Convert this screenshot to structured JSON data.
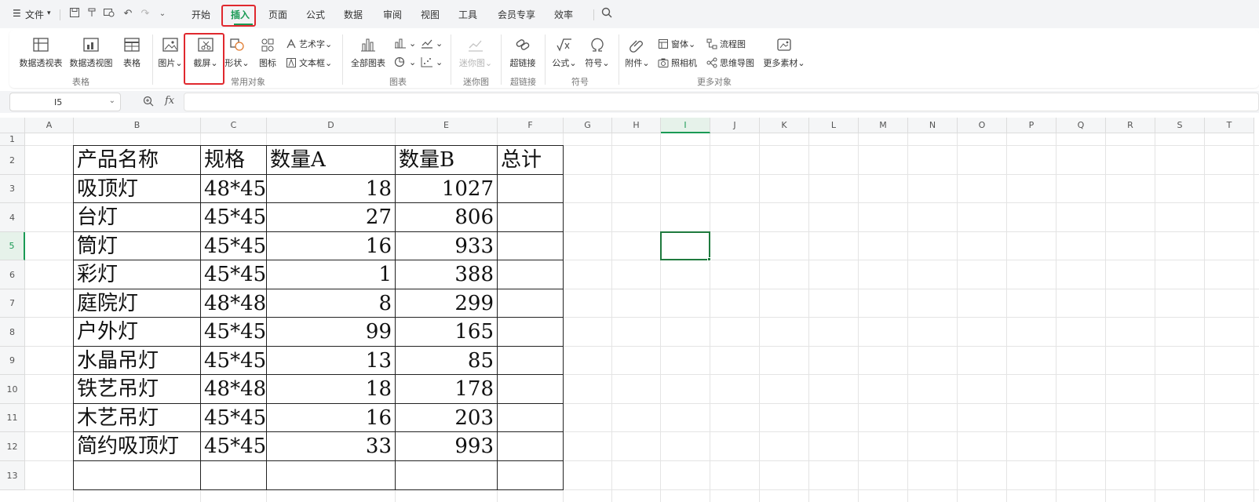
{
  "menu": {
    "file_label": "文件",
    "tabs": [
      {
        "label": "开始",
        "active": false
      },
      {
        "label": "插入",
        "active": true
      },
      {
        "label": "页面",
        "active": false
      },
      {
        "label": "公式",
        "active": false
      },
      {
        "label": "数据",
        "active": false
      },
      {
        "label": "审阅",
        "active": false
      },
      {
        "label": "视图",
        "active": false
      },
      {
        "label": "工具",
        "active": false
      },
      {
        "label": "会员专享",
        "active": false
      },
      {
        "label": "效率",
        "active": false
      }
    ]
  },
  "ribbon": {
    "table_group": {
      "name": "表格",
      "pivot_table": "数据透视表",
      "pivot_chart": "数据透视图",
      "table": "表格"
    },
    "common_group": {
      "name": "常用对象",
      "picture": "图片",
      "screenshot": "截屏",
      "shape": "形状",
      "icon": "图标",
      "wordart": "艺术字",
      "textbox": "文本框"
    },
    "chart_group": {
      "name": "图表",
      "all_charts": "全部图表"
    },
    "sparkline_group": {
      "name": "迷你图",
      "sparkline": "迷你图"
    },
    "hyperlink_group": {
      "name": "超链接",
      "hyperlink": "超链接"
    },
    "symbol_group": {
      "name": "符号",
      "formula": "公式",
      "symbol": "符号"
    },
    "more_group": {
      "name": "更多对象",
      "attachment": "附件",
      "window": "窗体",
      "camera": "照相机",
      "flowchart": "流程图",
      "mindmap": "思维导图",
      "more_material": "更多素材"
    }
  },
  "formula_bar": {
    "cell_ref": "I5",
    "fx": "fx",
    "value": ""
  },
  "accent_color": "#1a9a55",
  "highlight_color": "#e0282e",
  "sheet": {
    "columns": [
      "A",
      "B",
      "C",
      "D",
      "E",
      "F",
      "G",
      "H",
      "I",
      "J",
      "K",
      "L",
      "M",
      "N",
      "O",
      "P",
      "Q",
      "R",
      "S",
      "T"
    ],
    "rows": [
      "1",
      "2",
      "3",
      "4",
      "5",
      "6",
      "7",
      "8",
      "9",
      "10",
      "11",
      "12",
      "13"
    ],
    "selected_column": "I",
    "selected_row": "5",
    "header": [
      "产品名称",
      "规格",
      "数量A",
      "数量B",
      "总计"
    ],
    "data": [
      [
        "吸顶灯",
        "48*45",
        "18",
        "1027",
        ""
      ],
      [
        "台灯",
        "45*45",
        "27",
        "806",
        ""
      ],
      [
        "筒灯",
        "45*45",
        "16",
        "933",
        ""
      ],
      [
        "彩灯",
        "45*45",
        "1",
        "388",
        ""
      ],
      [
        "庭院灯",
        "48*48",
        "8",
        "299",
        ""
      ],
      [
        "户外灯",
        "45*45",
        "99",
        "165",
        ""
      ],
      [
        "水晶吊灯",
        "45*45",
        "13",
        "85",
        ""
      ],
      [
        "铁艺吊灯",
        "48*48",
        "18",
        "178",
        ""
      ],
      [
        "木艺吊灯",
        "45*45",
        "16",
        "203",
        ""
      ],
      [
        "简约吸顶灯",
        "45*45",
        "33",
        "993",
        ""
      ]
    ]
  }
}
